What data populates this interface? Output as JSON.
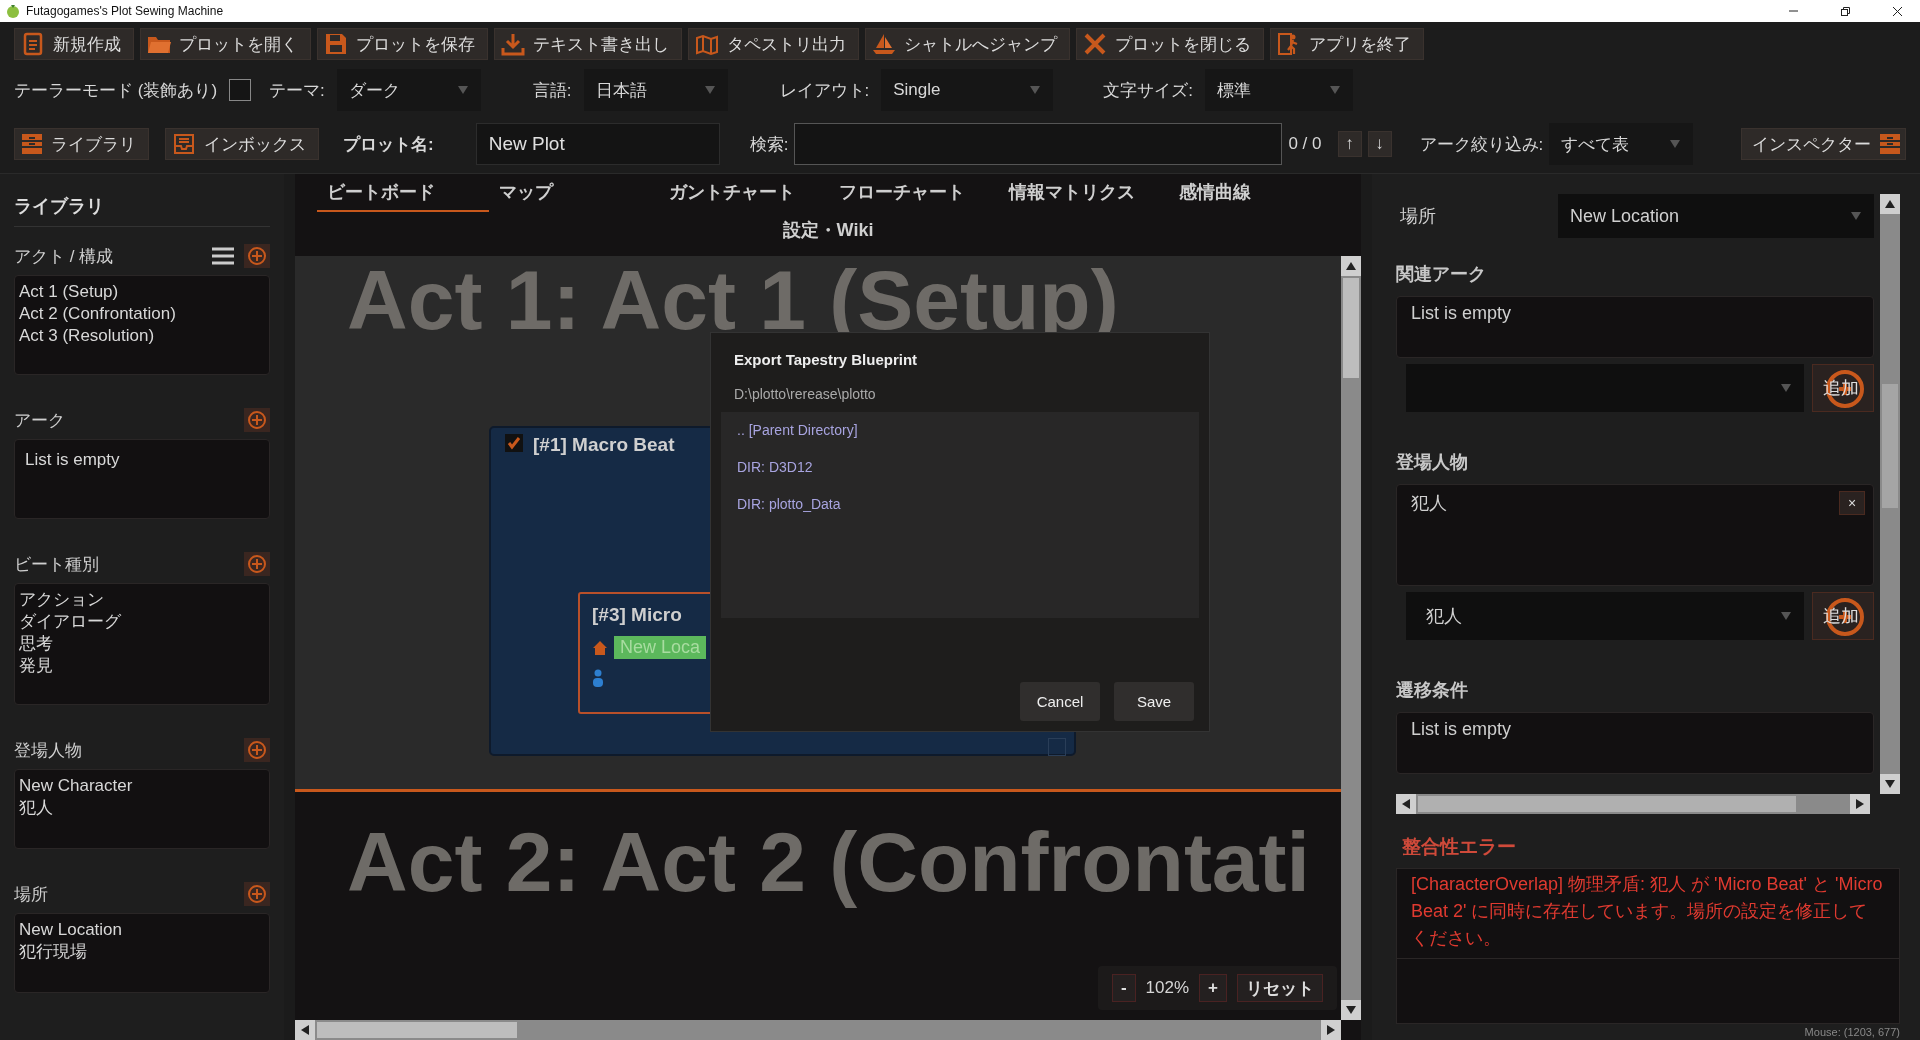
{
  "window": {
    "title": "Futagogames's Plot Sewing Machine"
  },
  "toolbar": [
    "新規作成",
    "プロットを開く",
    "プロットを保存",
    "テキスト書き出し",
    "タペストリ出力",
    "シャトルへジャンプ",
    "プロットを閉じる",
    "アプリを終了"
  ],
  "options": {
    "tailor_mode": {
      "label": "テーラーモード (装飾あり)",
      "checked": false
    },
    "selects": [
      {
        "label": "テーマ:",
        "value": "ダーク"
      },
      {
        "label": "言語:",
        "value": "日本語"
      },
      {
        "label": "レイアウト:",
        "value": "Single"
      },
      {
        "label": "文字サイズ:",
        "value": "標準"
      }
    ]
  },
  "plot_bar": {
    "library_button": "ライブラリ",
    "inbox_button": "インボックス",
    "plot_name_label": "プロット名:",
    "plot_name": "New Plot",
    "search_label": "検索:",
    "counter": "0 / 0",
    "up": "↑",
    "down": "↓",
    "arc_filter_label": "アーク絞り込み:",
    "arc_filter": "すべて表",
    "inspector_button": "インスペクター"
  },
  "library": {
    "title": "ライブラリ",
    "sections": [
      {
        "title": "アクト / 構成",
        "menu": true,
        "items": [
          "Act 1 (Setup)",
          "Act 2 (Confrontation)",
          "Act 3 (Resolution)"
        ]
      },
      {
        "title": "アーク",
        "menu": false,
        "empty_text": "List is empty"
      },
      {
        "title": "ビート種別",
        "menu": false,
        "items": [
          "アクション",
          "ダイアローグ",
          "思考",
          "発見"
        ]
      },
      {
        "title": "登場人物",
        "menu": false,
        "items": [
          "New Character",
          "犯人"
        ]
      },
      {
        "title": "場所",
        "menu": false,
        "items": [
          "New Location",
          "犯行現場"
        ]
      }
    ]
  },
  "tabs": [
    {
      "label": "ビートボード",
      "selected": true
    },
    {
      "label": "マップ",
      "selected": false
    },
    {
      "label": "ガントチャート",
      "selected": false
    },
    {
      "label": "フローチャート",
      "selected": false
    },
    {
      "label": "情報マトリクス",
      "selected": false
    },
    {
      "label": "感情曲線",
      "selected": false
    },
    {
      "label": "設定・Wiki",
      "selected": false
    }
  ],
  "board": {
    "acts": [
      {
        "heading": "Act 1: Act 1 (Setup)",
        "beats": [
          {
            "title": "[#1] Macro Beat",
            "checked": true,
            "children": [
              {
                "title": "[#3] Micro",
                "location": "New Loca"
              }
            ]
          }
        ]
      },
      {
        "heading": "Act 2: Act 2 (Confrontati"
      }
    ],
    "zoom": {
      "minus": "-",
      "level_text": "102%",
      "plus": "+",
      "reset": "リセット"
    }
  },
  "dialog": {
    "title": "Export Tapestry Blueprint",
    "path": "D:\\plotto\\rerease\\plotto",
    "entries": [
      ".. [Parent Directory]",
      "DIR: D3D12",
      "DIR: plotto_Data"
    ],
    "buttons": [
      "Cancel",
      "Save"
    ]
  },
  "inspector": {
    "location": {
      "label": "場所",
      "value": "New Location"
    },
    "sections": [
      {
        "title": "関連アーク",
        "empty_text": "List is empty",
        "add_label": "追加"
      },
      {
        "title": "登場人物",
        "items": [
          {
            "name": "犯人",
            "remove": "×"
          }
        ],
        "select_value": "犯人",
        "add_label": "追加"
      },
      {
        "title": "遷移条件",
        "empty_text": "List is empty"
      }
    ],
    "errors": {
      "title": "整合性エラー",
      "messages": [
        "[CharacterOverlap] 物理矛盾: 犯人 が 'Micro Beat' と 'Micro Beat 2' に同時に存在しています。場所の設定を修正してください。"
      ]
    },
    "mouse": "Mouse: (1203, 677)"
  }
}
